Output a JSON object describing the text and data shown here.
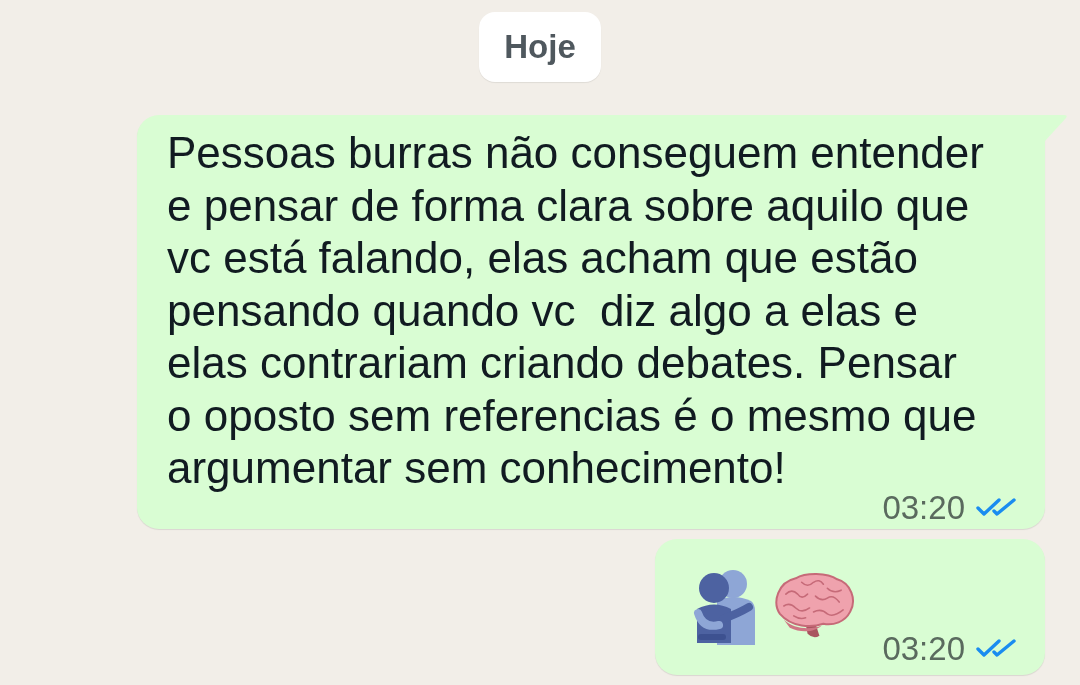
{
  "date_chip": {
    "label": "Hoje"
  },
  "messages": [
    {
      "kind": "text",
      "tail": true,
      "text": "Pessoas burras não conseguem entender e pensar de forma clara sobre aquilo que vc está falando, elas acham que estão pensando quando vc  diz algo a elas e elas contrariam criando debates. Pensar o oposto sem referencias é o mesmo que argumentar sem conhecimento!",
      "time": "03:20",
      "read": true
    },
    {
      "kind": "emoji",
      "tail": false,
      "emojis": [
        {
          "kind": "hug"
        },
        {
          "kind": "brain"
        }
      ],
      "time": "03:20",
      "read": true
    }
  ]
}
